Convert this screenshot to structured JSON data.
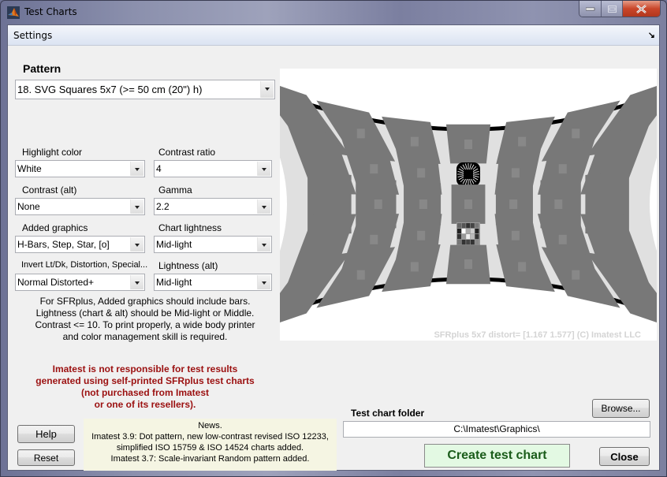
{
  "window": {
    "title": "Test Charts",
    "icon": "matlab-icon",
    "caption_buttons": [
      "minimize",
      "maximize",
      "close"
    ]
  },
  "menubar": {
    "items": [
      {
        "label": "Settings"
      }
    ],
    "dock_arrow": "↘"
  },
  "pattern": {
    "heading": "Pattern",
    "selected": "18. SVG Squares 5x7 (>= 50 cm (20\") h)"
  },
  "fields": {
    "highlight_color": {
      "label": "Highlight color",
      "value": "White"
    },
    "contrast_ratio": {
      "label": "Contrast ratio",
      "value": "4"
    },
    "contrast_alt": {
      "label": "Contrast (alt)",
      "value": "None"
    },
    "gamma": {
      "label": "Gamma",
      "value": "2.2"
    },
    "added_graphics": {
      "label": "Added graphics",
      "value": "H-Bars, Step, Star, [o]"
    },
    "chart_lightness": {
      "label": "Chart lightness",
      "value": "Mid-light"
    },
    "invert": {
      "label": "Invert Lt/Dk, Distortion, Special...",
      "value": "Normal Distorted+"
    },
    "lightness_alt": {
      "label": "Lightness (alt)",
      "value": "Mid-light"
    }
  },
  "info_lines": [
    "For SFRplus, Added graphics should include bars.",
    "Lightness (chart & alt) should be Mid-light or Middle.",
    "Contrast <= 10. To print properly, a wide body printer",
    "and color management skill is required."
  ],
  "warning_lines": [
    "Imatest is not responsible for test results",
    "generated using self-printed SFRplus test charts",
    "(not purchased from Imatest",
    "or one of its resellers)."
  ],
  "buttons": {
    "help": "Help",
    "reset": "Reset",
    "browse": "Browse...",
    "create": "Create test chart",
    "close": "Close"
  },
  "news_lines": [
    "News.",
    "Imatest 3.9: Dot pattern, new low-contrast revised ISO 12233,",
    "simplified ISO 15759 & ISO 14524 charts added.",
    "Imatest 3.7: Scale-invariant Random pattern added."
  ],
  "folder": {
    "label": "Test chart folder",
    "value": "C:\\Imatest\\Graphics\\"
  },
  "preview": {
    "caption": "SFRplus 5x7   distort= [1.167  1.577]   (C) Imatest LLC",
    "rows": 5,
    "cols": 7,
    "distortion": [
      1.167,
      1.577
    ],
    "colors": {
      "background": "#e0e0e0",
      "square": "#787878",
      "bars": "#000000",
      "outside": "#ffffff"
    }
  }
}
